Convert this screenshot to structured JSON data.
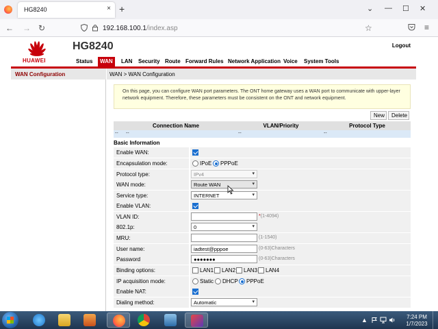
{
  "browser": {
    "tab_title": "HG8240",
    "tab_close": "×",
    "new_tab": "+",
    "url_host": "192.168.100.1",
    "url_path": "/index.asp",
    "window_controls": {
      "dropdown": "⌄",
      "minimize": "—",
      "maximize": "☐",
      "close": "✕"
    },
    "nav_icons": {
      "back": "←",
      "forward": "→",
      "reload": "↻",
      "star": "☆",
      "menu": "≡"
    }
  },
  "router": {
    "brand": "HUAWEI",
    "product": "HG8240",
    "logout": "Logout",
    "menu": [
      "Status",
      "WAN",
      "LAN",
      "Security",
      "Route",
      "Forward Rules",
      "Network Application",
      "Voice",
      "System Tools"
    ],
    "active_menu": "WAN",
    "sidebar_item": "WAN Configuration",
    "breadcrumb": "WAN > WAN Configuration",
    "notice": "On this page, you can configure WAN port parameters. The ONT home gateway uses a WAN port to communicate with upper-layer network equipment. Therefore, these parameters must be consistent on the ONT and network equipment.",
    "buttons": {
      "new": "New",
      "delete": "Delete"
    },
    "table": {
      "headers": [
        "Connection Name",
        "VLAN/Priority",
        "Protocol Type"
      ],
      "row": [
        "--",
        "--",
        "--",
        "--"
      ]
    },
    "section_title": "Basic Information",
    "form": {
      "enable_wan": {
        "label": "Enable WAN:",
        "checked": true
      },
      "encapsulation": {
        "label": "Encapsulation mode:",
        "options": [
          "IPoE",
          "PPPoE"
        ],
        "selected": "PPPoE"
      },
      "protocol_type": {
        "label": "Protocol type:",
        "value": "IPv4"
      },
      "wan_mode": {
        "label": "WAN mode:",
        "value": "Route WAN"
      },
      "service_type": {
        "label": "Service type:",
        "value": "INTERNET"
      },
      "enable_vlan": {
        "label": "Enable VLAN:",
        "checked": true
      },
      "vlan_id": {
        "label": "VLAN ID:",
        "value": "",
        "required": "*",
        "hint": "(1-4094)"
      },
      "priority": {
        "label": "802.1p:",
        "value": "0"
      },
      "mru": {
        "label": "MRU:",
        "value": "",
        "hint": "(1-1540)"
      },
      "user_name": {
        "label": "User name:",
        "value": "iadtest@pppoe",
        "hint": "(0-63)Characters"
      },
      "password": {
        "label": "Password",
        "value": "●●●●●●●",
        "hint": "(0-63)Characters"
      },
      "binding": {
        "label": "Binding options:",
        "options": [
          "LAN1",
          "LAN2",
          "LAN3",
          "LAN4"
        ]
      },
      "ip_mode": {
        "label": "IP acquisition mode:",
        "options": [
          "Static",
          "DHCP",
          "PPPoE"
        ],
        "selected": "PPPoE"
      },
      "enable_nat": {
        "label": "Enable NAT:",
        "checked": true
      },
      "dialing": {
        "label": "Dialing method:",
        "value": "Automatic"
      }
    }
  },
  "taskbar": {
    "time": "7:24 PM",
    "date": "1/7/2023",
    "tray_up": "▲"
  },
  "colors": {
    "brand_red": "#c7000b",
    "checkbox_blue": "#1a6fd0",
    "notice_bg": "#ffffe0"
  }
}
